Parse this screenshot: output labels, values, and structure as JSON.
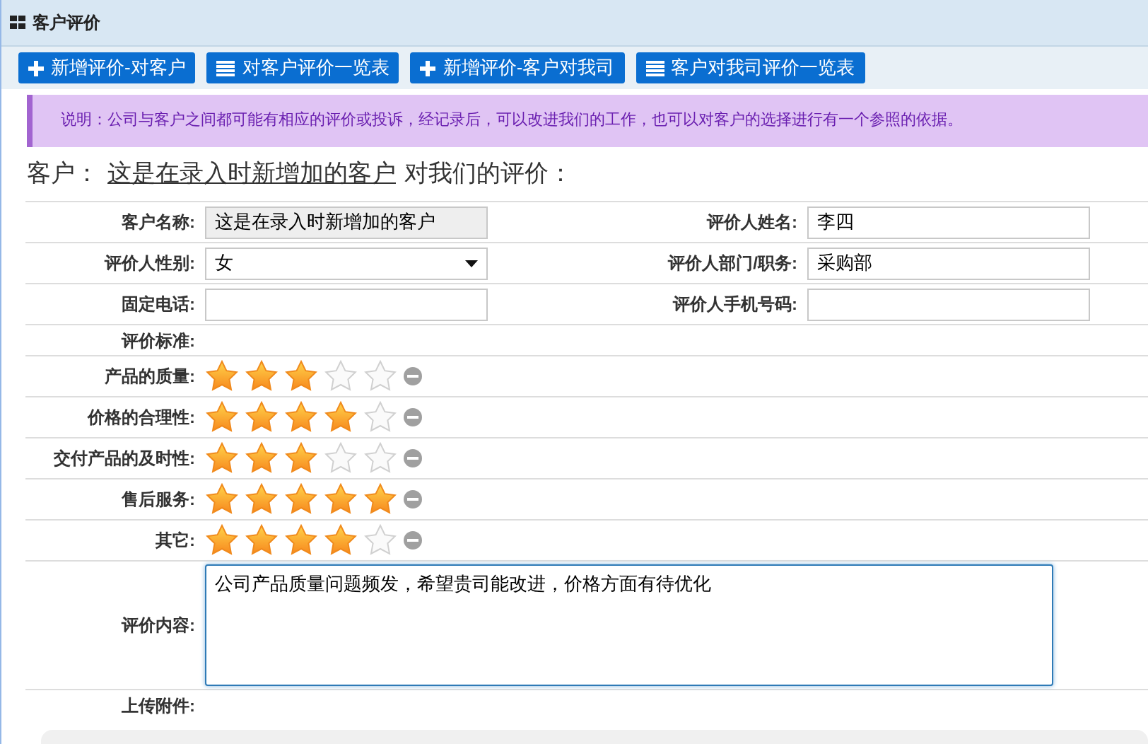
{
  "panel": {
    "title": "客户评价"
  },
  "toolbar": [
    {
      "kind": "add",
      "label": "新增评价-对客户"
    },
    {
      "kind": "list",
      "label": "对客户评价一览表"
    },
    {
      "kind": "add",
      "label": "新增评价-客户对我司"
    },
    {
      "kind": "list",
      "label": "客户对我司评价一览表"
    }
  ],
  "note": "说明：公司与客户之间都可能有相应的评价或投诉，经记录后，可以改进我们的工作，也可以对客户的选择进行有一个参照的依据。",
  "heading": {
    "prefix": "客户：",
    "customer": "这是在录入时新增加的客户",
    "suffix": "对我们的评价："
  },
  "fields": [
    [
      {
        "label": "客户名称:",
        "kind": "readonly",
        "value": "这是在录入时新增加的客户"
      },
      {
        "label": "评价人姓名:",
        "kind": "text",
        "value": "李四"
      }
    ],
    [
      {
        "label": "评价人性别:",
        "kind": "select",
        "value": "女"
      },
      {
        "label": "评价人部门/职务:",
        "kind": "text",
        "value": "采购部"
      }
    ],
    [
      {
        "label": "固定电话:",
        "kind": "text"
      },
      {
        "label": "评价人手机号码:",
        "kind": "text"
      }
    ]
  ],
  "criteria_label": "评价标准:",
  "ratings": [
    {
      "label": "产品的质量:",
      "stars": 3
    },
    {
      "label": "价格的合理性:",
      "stars": 4
    },
    {
      "label": "交付产品的及时性:",
      "stars": 3
    },
    {
      "label": "售后服务:",
      "stars": 5
    },
    {
      "label": "其它:",
      "stars": 4
    }
  ],
  "comment": {
    "label": "评价内容:",
    "value": "公司产品质量问题频发，希望贵司能改进，价格方面有待优化"
  },
  "attachment_label": "上传附件:"
}
